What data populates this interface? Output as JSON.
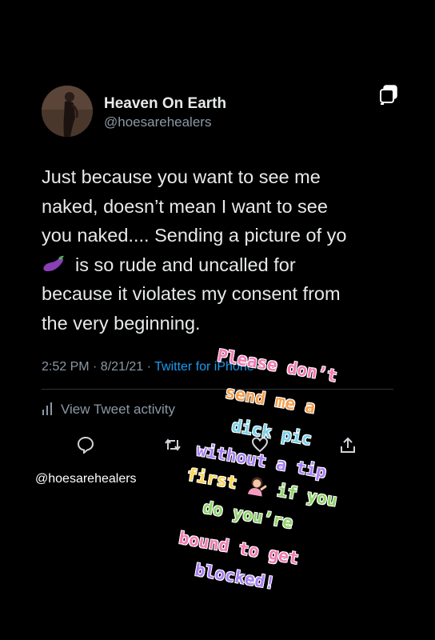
{
  "user": {
    "display_name": "Heaven On Earth",
    "handle": "@hoesarehealers"
  },
  "tweet": {
    "lines": [
      "Just because you want to see me",
      "naked, doesn’t mean I want to see",
      "you naked.... Sending a picture of yo",
      "is so rude and uncalled for",
      "because it violates my consent from",
      "the very beginning."
    ],
    "emoji": "eggplant-icon",
    "timestamp": "2:52 PM · 8/21/21 · ",
    "source": "Twitter for iPhone"
  },
  "activity_label": "View Tweet activity",
  "watermark": "@hoesarehealers",
  "overlay": {
    "lines": [
      "Please don’t",
      "send me a",
      "dick pic",
      "without a tip",
      "first",
      "if you",
      "do you’re",
      "bound to get",
      "blocked!"
    ],
    "emoji": "person-tipping-hand-icon"
  },
  "colors": {
    "background": "#000000",
    "text": "#e7e9ea",
    "secondary": "#8b98a5",
    "link": "#1d9bf0"
  }
}
